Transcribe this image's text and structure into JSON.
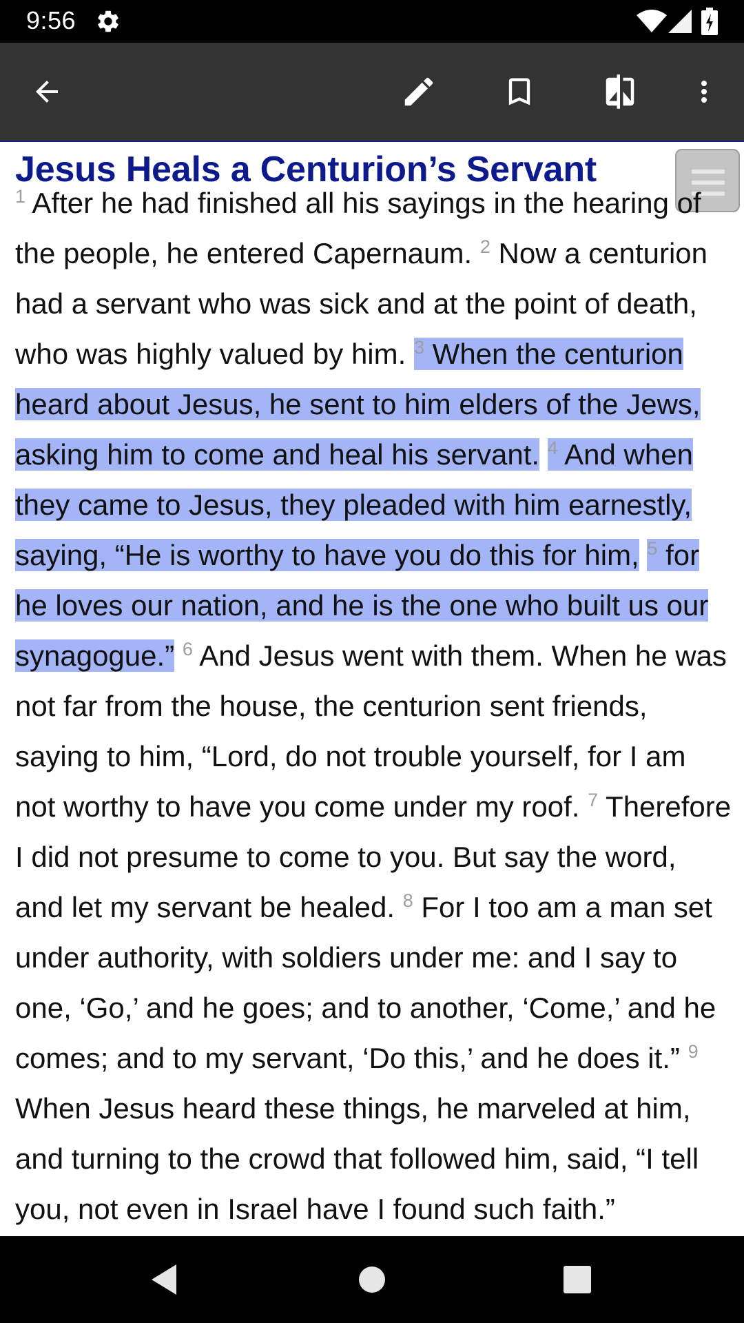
{
  "status_bar": {
    "time": "9:56",
    "icons": [
      "gear-icon",
      "wifi-icon",
      "signal-icon",
      "battery-icon"
    ]
  },
  "toolbar": {
    "icons": [
      "back-arrow-icon",
      "pencil-icon",
      "bookmark-icon",
      "compare-icon",
      "more-vert-icon"
    ],
    "background": "#333333",
    "accent": "#1a237e"
  },
  "passage": {
    "heading": "Jesus Heals a Centurion’s Servant",
    "heading_color": "#0d1a8c",
    "highlight_color": "#a3b4f7",
    "verses": {
      "v1": {
        "num": "1",
        "text": "After he had finished all his sayings in the hearing of the people, he entered Capernaum."
      },
      "v2": {
        "num": "2",
        "text": "Now a centurion had a servant who was sick and at the point of death, who was highly valued by him."
      },
      "v3": {
        "num": "3",
        "text": "When the centurion heard about Jesus, he sent to him elders of the Jews, asking him to come and heal his servant."
      },
      "v4": {
        "num": "4",
        "text": "And when they came to Jesus, they pleaded with him earnestly, saying, “He is worthy to have you do this for him,"
      },
      "v5": {
        "num": "5",
        "text": "for he loves our nation, and he is the one who built us our synagogue.”"
      },
      "v6": {
        "num": "6",
        "text": "And Jesus went with them. When he was not far from the house, the centurion sent friends, saying to him, “Lord, do not trouble yourself, for I am not worthy to have you come under my roof."
      },
      "v7": {
        "num": "7",
        "text": "Therefore I did not presume to come to you. But say the word, and let my servant be healed."
      },
      "v8": {
        "num": "8",
        "text": "For I too am a man set under authority, with soldiers under me: and I say to one, ‘Go,’ and he goes; and to another, ‘Come,’ and he comes; and to my servant, ‘Do this,’ and he does it.”"
      },
      "v9": {
        "num": "9",
        "text": "When Jesus heard these things, he marveled at him, and turning to the crowd that followed him, said, “I tell you, not even in Israel have I found such faith.”"
      }
    },
    "highlighted_verses": [
      "3",
      "4",
      "5"
    ]
  },
  "nav_bar": {
    "icons": [
      "back-triangle-icon",
      "home-circle-icon",
      "recents-square-icon"
    ]
  }
}
